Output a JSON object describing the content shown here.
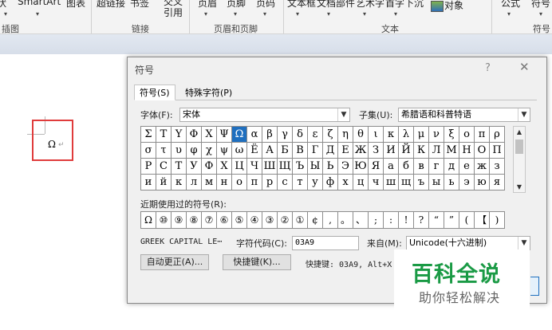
{
  "ribbon": {
    "commands": [
      "状",
      "SmartArt",
      "图表",
      "超链接",
      "书签",
      "交叉引用",
      "页眉",
      "页脚",
      "页码",
      "文本框",
      "文档部件",
      "艺术字",
      "首字下沉",
      "对象",
      "公式",
      "符号"
    ],
    "groups": [
      "插图",
      "链接",
      "页眉和页脚",
      "文本",
      "符号"
    ]
  },
  "document": {
    "inserted_char": "Ω",
    "paragraph_mark": "↵"
  },
  "dialog": {
    "title": "符号",
    "help": "?",
    "close": "✕",
    "tabs": [
      "符号(S)",
      "特殊字符(P)"
    ],
    "font_label": "字体(F):",
    "font_value": "宋体",
    "subset_label": "子集(U):",
    "subset_value": "希腊语和科普特语",
    "symbols": [
      [
        "Σ",
        "Τ",
        "Υ",
        "Φ",
        "Χ",
        "Ψ",
        "Ω",
        "α",
        "β",
        "γ",
        "δ",
        "ε",
        "ζ",
        "η",
        "θ",
        "ι",
        "κ",
        "λ",
        "μ",
        "ν",
        "ξ",
        "ο",
        "π",
        "ρ"
      ],
      [
        "σ",
        "τ",
        "υ",
        "φ",
        "χ",
        "ψ",
        "ω",
        "Ë",
        "А",
        "Б",
        "В",
        "Г",
        "Д",
        "Е",
        "Ж",
        "З",
        "И",
        "Й",
        "К",
        "Л",
        "М",
        "Н",
        "О",
        "П"
      ],
      [
        "Р",
        "С",
        "Т",
        "У",
        "Ф",
        "Х",
        "Ц",
        "Ч",
        "Ш",
        "Щ",
        "Ъ",
        "Ы",
        "Ь",
        "Э",
        "Ю",
        "Я",
        "а",
        "б",
        "в",
        "г",
        "д",
        "е",
        "ж",
        "з"
      ],
      [
        "и",
        "й",
        "к",
        "л",
        "м",
        "н",
        "о",
        "п",
        "р",
        "с",
        "т",
        "у",
        "ф",
        "х",
        "ц",
        "ч",
        "ш",
        "щ",
        "ъ",
        "ы",
        "ь",
        "э",
        "ю",
        "я"
      ]
    ],
    "recent_label": "近期使用过的符号(R):",
    "recent": [
      "Ω",
      "⑩",
      "⑨",
      "⑧",
      "⑦",
      "⑥",
      "⑤",
      "④",
      "③",
      "②",
      "①",
      "¢",
      ",",
      "。",
      "、",
      ";",
      ":",
      "!",
      "?",
      "“",
      "”",
      "(",
      "【",
      ")"
    ],
    "char_name": "GREEK CAPITAL LE⋯",
    "code_label": "字符代码(C):",
    "code_value": "03A9",
    "from_label": "来自(M):",
    "from_value": "Unicode(十六进制)",
    "autocorrect_button": "自动更正(A)...",
    "shortcut_button": "快捷键(K)...",
    "shortcut_text": "快捷键: 03A9, Alt+X"
  },
  "watermark": {
    "title": "百科全说",
    "subtitle": "助你轻松解决"
  }
}
